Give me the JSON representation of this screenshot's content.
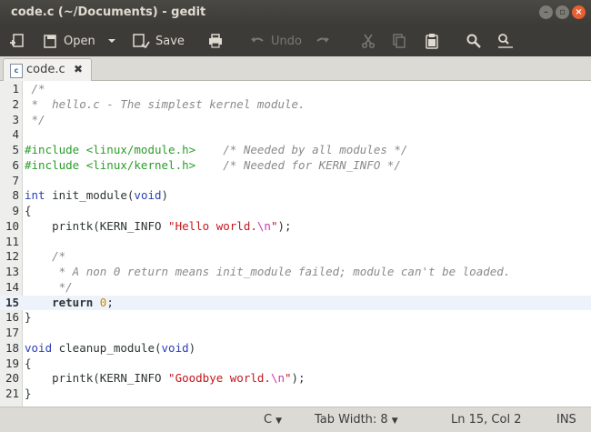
{
  "window": {
    "title": "code.c (~/Documents) - gedit"
  },
  "toolbar": {
    "open_label": "Open",
    "save_label": "Save",
    "undo_label": "Undo"
  },
  "tab": {
    "label": "code.c",
    "icon_text": "c",
    "close_glyph": "✖"
  },
  "editor": {
    "current_line": 15,
    "lines": [
      [
        {
          "t": " /*",
          "c": "cmt"
        }
      ],
      [
        {
          "t": " *  hello.c - The simplest kernel module.",
          "c": "cmt"
        }
      ],
      [
        {
          "t": " */",
          "c": "cmt"
        }
      ],
      [],
      [
        {
          "t": "#include <linux/module.h>",
          "c": "pp"
        },
        {
          "t": "    ",
          "c": ""
        },
        {
          "t": "/* Needed by all modules */",
          "c": "cmt"
        }
      ],
      [
        {
          "t": "#include <linux/kernel.h>",
          "c": "pp"
        },
        {
          "t": "    ",
          "c": ""
        },
        {
          "t": "/* Needed for KERN_INFO */",
          "c": "cmt"
        }
      ],
      [],
      [
        {
          "t": "int",
          "c": "kw"
        },
        {
          "t": " init_module(",
          "c": ""
        },
        {
          "t": "void",
          "c": "kw"
        },
        {
          "t": ")",
          "c": ""
        }
      ],
      [
        {
          "t": "{",
          "c": ""
        }
      ],
      [
        {
          "t": "    printk(KERN_INFO ",
          "c": ""
        },
        {
          "t": "\"Hello world.",
          "c": "str"
        },
        {
          "t": "\\n",
          "c": "esc"
        },
        {
          "t": "\"",
          "c": "str"
        },
        {
          "t": ");",
          "c": ""
        }
      ],
      [],
      [
        {
          "t": "    /*",
          "c": "cmt"
        }
      ],
      [
        {
          "t": "     * A non 0 return means init_module failed; module can't be loaded.",
          "c": "cmt"
        }
      ],
      [
        {
          "t": "     */",
          "c": "cmt"
        }
      ],
      [
        {
          "t": "    ",
          "c": ""
        },
        {
          "t": "return",
          "c": "kwb"
        },
        {
          "t": " ",
          "c": ""
        },
        {
          "t": "0",
          "c": "num"
        },
        {
          "t": ";",
          "c": ""
        }
      ],
      [
        {
          "t": "}",
          "c": ""
        }
      ],
      [],
      [
        {
          "t": "void",
          "c": "kw"
        },
        {
          "t": " cleanup_module(",
          "c": ""
        },
        {
          "t": "void",
          "c": "kw"
        },
        {
          "t": ")",
          "c": ""
        }
      ],
      [
        {
          "t": "{",
          "c": ""
        }
      ],
      [
        {
          "t": "    printk(KERN_INFO ",
          "c": ""
        },
        {
          "t": "\"Goodbye world.",
          "c": "str"
        },
        {
          "t": "\\n",
          "c": "esc"
        },
        {
          "t": "\"",
          "c": "str"
        },
        {
          "t": ");",
          "c": ""
        }
      ],
      [
        {
          "t": "}",
          "c": ""
        }
      ]
    ]
  },
  "statusbar": {
    "language": "C",
    "tab_width": "Tab Width:  8",
    "position": "Ln 15, Col 2",
    "mode": "INS"
  },
  "colors": {
    "comment": "#8a8a8a",
    "preprocessor": "#2a9d2a",
    "keyword": "#2a3fb5",
    "string": "#c4161c",
    "escape": "#c837ab",
    "number": "#c88a00",
    "close_button": "#e95f2f",
    "current_line": "#eef3fb"
  },
  "icons": [
    "new-document-icon",
    "open-folder-icon",
    "dropdown-arrow-icon",
    "save-icon",
    "print-icon",
    "undo-icon",
    "redo-icon",
    "cut-icon",
    "copy-icon",
    "paste-icon",
    "search-icon",
    "search-replace-icon",
    "minimize-icon",
    "maximize-icon",
    "close-icon",
    "c-source-file-icon",
    "tab-close-icon"
  ]
}
